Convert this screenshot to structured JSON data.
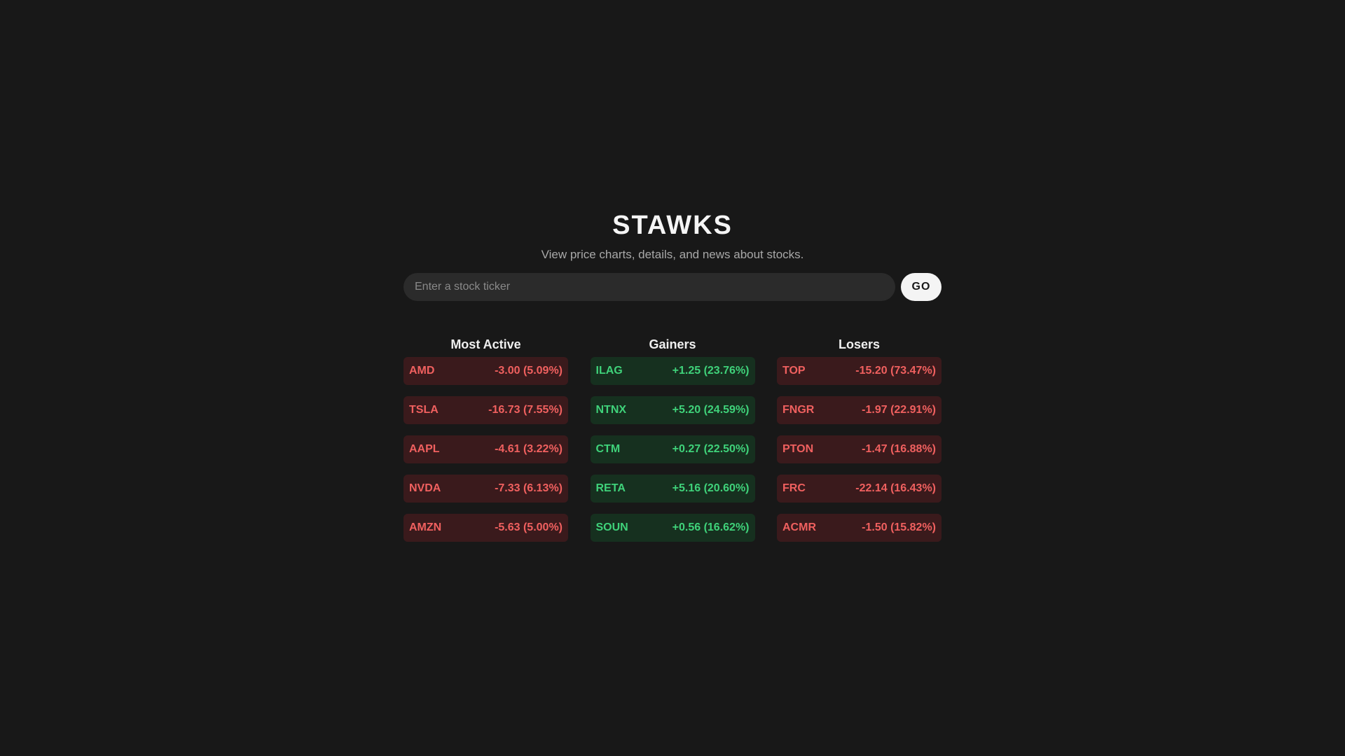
{
  "app": {
    "title": "STAWKS",
    "subtitle": "View price charts, details, and news about stocks."
  },
  "search": {
    "placeholder": "Enter a stock ticker",
    "value": "",
    "go_label": "GO"
  },
  "colors": {
    "background": "#181818",
    "down_text": "#f0605f",
    "down_bg": "#3a1a1c",
    "up_text": "#3fd27a",
    "up_bg": "#16301f"
  },
  "lists": [
    {
      "heading": "Most Active",
      "items": [
        {
          "ticker": "AMD",
          "change": "-3.00 (5.09%)",
          "direction": "down"
        },
        {
          "ticker": "TSLA",
          "change": "-16.73 (7.55%)",
          "direction": "down"
        },
        {
          "ticker": "AAPL",
          "change": "-4.61 (3.22%)",
          "direction": "down"
        },
        {
          "ticker": "NVDA",
          "change": "-7.33 (6.13%)",
          "direction": "down"
        },
        {
          "ticker": "AMZN",
          "change": "-5.63 (5.00%)",
          "direction": "down"
        }
      ]
    },
    {
      "heading": "Gainers",
      "items": [
        {
          "ticker": "ILAG",
          "change": "+1.25 (23.76%)",
          "direction": "up"
        },
        {
          "ticker": "NTNX",
          "change": "+5.20 (24.59%)",
          "direction": "up"
        },
        {
          "ticker": "CTM",
          "change": "+0.27 (22.50%)",
          "direction": "up"
        },
        {
          "ticker": "RETA",
          "change": "+5.16 (20.60%)",
          "direction": "up"
        },
        {
          "ticker": "SOUN",
          "change": "+0.56 (16.62%)",
          "direction": "up"
        }
      ]
    },
    {
      "heading": "Losers",
      "items": [
        {
          "ticker": "TOP",
          "change": "-15.20 (73.47%)",
          "direction": "down"
        },
        {
          "ticker": "FNGR",
          "change": "-1.97 (22.91%)",
          "direction": "down"
        },
        {
          "ticker": "PTON",
          "change": "-1.47 (16.88%)",
          "direction": "down"
        },
        {
          "ticker": "FRC",
          "change": "-22.14 (16.43%)",
          "direction": "down"
        },
        {
          "ticker": "ACMR",
          "change": "-1.50 (15.82%)",
          "direction": "down"
        }
      ]
    }
  ]
}
